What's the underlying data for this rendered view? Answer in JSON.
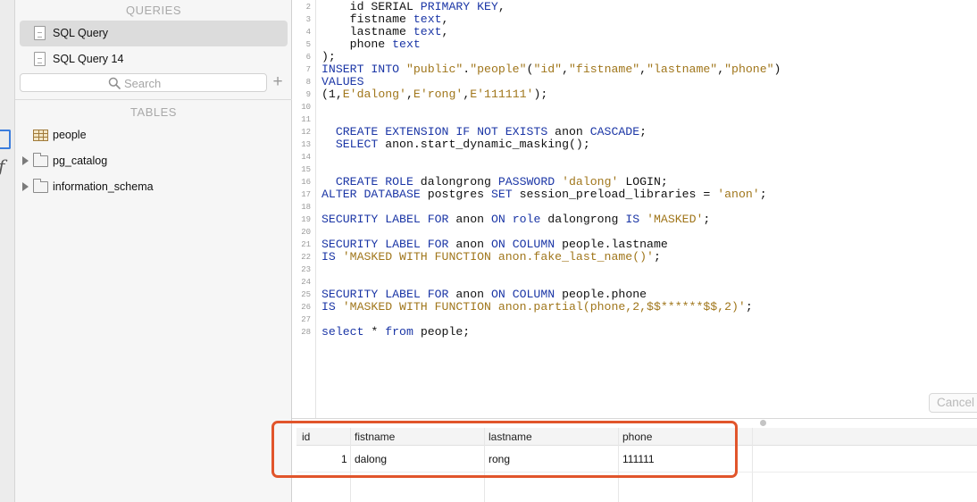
{
  "sidebar": {
    "queries_heading": "QUERIES",
    "queries": [
      {
        "label": "SQL Query",
        "selected": true
      },
      {
        "label": "SQL Query 14",
        "selected": false
      }
    ],
    "search_placeholder": "Search",
    "add_label": "+",
    "tables_heading": "TABLES",
    "tables": [
      {
        "label": "people",
        "type": "table"
      },
      {
        "label": "pg_catalog",
        "type": "schema"
      },
      {
        "label": "information_schema",
        "type": "schema"
      }
    ]
  },
  "left_strip": {
    "function_glyph": "ƒ"
  },
  "editor": {
    "lines": [
      {
        "n": "2",
        "tokens": [
          [
            "pl",
            "    id SERIAL "
          ],
          [
            "kw",
            "PRIMARY KEY"
          ],
          [
            "pl",
            ","
          ]
        ]
      },
      {
        "n": "3",
        "tokens": [
          [
            "pl",
            "    fistname "
          ],
          [
            "kw",
            "text"
          ],
          [
            "pl",
            ","
          ]
        ]
      },
      {
        "n": "4",
        "tokens": [
          [
            "pl",
            "    lastname "
          ],
          [
            "kw",
            "text"
          ],
          [
            "pl",
            ","
          ]
        ]
      },
      {
        "n": "5",
        "tokens": [
          [
            "pl",
            "    phone "
          ],
          [
            "kw",
            "text"
          ]
        ]
      },
      {
        "n": "6",
        "tokens": [
          [
            "pl",
            ");"
          ]
        ]
      },
      {
        "n": "7",
        "tokens": [
          [
            "kw",
            "INSERT INTO "
          ],
          [
            "str",
            "\"public\""
          ],
          [
            "pl",
            "."
          ],
          [
            "str",
            "\"people\""
          ],
          [
            "pl",
            "("
          ],
          [
            "str",
            "\"id\""
          ],
          [
            "pl",
            ","
          ],
          [
            "str",
            "\"fistname\""
          ],
          [
            "pl",
            ","
          ],
          [
            "str",
            "\"lastname\""
          ],
          [
            "pl",
            ","
          ],
          [
            "str",
            "\"phone\""
          ],
          [
            "pl",
            ")"
          ]
        ]
      },
      {
        "n": "8",
        "tokens": [
          [
            "kw",
            "VALUES"
          ]
        ]
      },
      {
        "n": "9",
        "tokens": [
          [
            "pl",
            "(1,"
          ],
          [
            "str",
            "E'dalong'"
          ],
          [
            "pl",
            ","
          ],
          [
            "str",
            "E'rong'"
          ],
          [
            "pl",
            ","
          ],
          [
            "str",
            "E'111111'"
          ],
          [
            "pl",
            ");"
          ]
        ]
      },
      {
        "n": "10",
        "tokens": []
      },
      {
        "n": "11",
        "tokens": []
      },
      {
        "n": "12",
        "tokens": [
          [
            "pl",
            "  "
          ],
          [
            "kw",
            "CREATE EXTENSION IF NOT EXISTS "
          ],
          [
            "pl",
            "anon "
          ],
          [
            "kw",
            "CASCADE"
          ],
          [
            "pl",
            ";"
          ]
        ]
      },
      {
        "n": "13",
        "tokens": [
          [
            "pl",
            "  "
          ],
          [
            "kw",
            "SELECT "
          ],
          [
            "pl",
            "anon.start_dynamic_masking();"
          ]
        ]
      },
      {
        "n": "14",
        "tokens": []
      },
      {
        "n": "15",
        "tokens": []
      },
      {
        "n": "16",
        "tokens": [
          [
            "pl",
            "  "
          ],
          [
            "kw",
            "CREATE ROLE "
          ],
          [
            "pl",
            "dalongrong "
          ],
          [
            "kw",
            "PASSWORD "
          ],
          [
            "str",
            "'dalong'"
          ],
          [
            "pl",
            " LOGIN;"
          ]
        ]
      },
      {
        "n": "17",
        "tokens": [
          [
            "kw",
            "ALTER DATABASE "
          ],
          [
            "pl",
            "postgres "
          ],
          [
            "kw",
            "SET "
          ],
          [
            "pl",
            "session_preload_libraries = "
          ],
          [
            "str",
            "'anon'"
          ],
          [
            "pl",
            ";"
          ]
        ]
      },
      {
        "n": "18",
        "tokens": []
      },
      {
        "n": "19",
        "tokens": [
          [
            "kw",
            "SECURITY LABEL FOR "
          ],
          [
            "pl",
            "anon "
          ],
          [
            "kw",
            "ON "
          ],
          [
            "kw",
            "role "
          ],
          [
            "pl",
            "dalongrong "
          ],
          [
            "kw",
            "IS "
          ],
          [
            "str",
            "'MASKED'"
          ],
          [
            "pl",
            ";"
          ]
        ]
      },
      {
        "n": "20",
        "tokens": []
      },
      {
        "n": "21",
        "tokens": [
          [
            "kw",
            "SECURITY LABEL FOR "
          ],
          [
            "pl",
            "anon "
          ],
          [
            "kw",
            "ON COLUMN "
          ],
          [
            "pl",
            "people.lastname"
          ]
        ]
      },
      {
        "n": "22",
        "tokens": [
          [
            "kw",
            "IS "
          ],
          [
            "str",
            "'MASKED WITH FUNCTION anon.fake_last_name()'"
          ],
          [
            "pl",
            ";"
          ]
        ]
      },
      {
        "n": "23",
        "tokens": []
      },
      {
        "n": "24",
        "tokens": []
      },
      {
        "n": "25",
        "tokens": [
          [
            "kw",
            "SECURITY LABEL FOR "
          ],
          [
            "pl",
            "anon "
          ],
          [
            "kw",
            "ON COLUMN "
          ],
          [
            "pl",
            "people.phone"
          ]
        ]
      },
      {
        "n": "26",
        "tokens": [
          [
            "kw",
            "IS "
          ],
          [
            "str",
            "'MASKED WITH FUNCTION anon.partial(phone,2,$$******$$,2)'"
          ],
          [
            "pl",
            ";"
          ]
        ]
      },
      {
        "n": "27",
        "tokens": []
      },
      {
        "n": "28",
        "tokens": [
          [
            "kw",
            "select "
          ],
          [
            "pl",
            "* "
          ],
          [
            "kw",
            "from "
          ],
          [
            "pl",
            "people;"
          ]
        ]
      }
    ],
    "cancel_label": "Cancel"
  },
  "results": {
    "columns": [
      "id",
      "fistname",
      "lastname",
      "phone"
    ],
    "rows": [
      [
        "1",
        "dalong",
        "rong",
        "111111"
      ]
    ]
  },
  "colors": {
    "keyword": "#1b36a6",
    "string": "#a0761b",
    "highlight": "#e1552b"
  }
}
